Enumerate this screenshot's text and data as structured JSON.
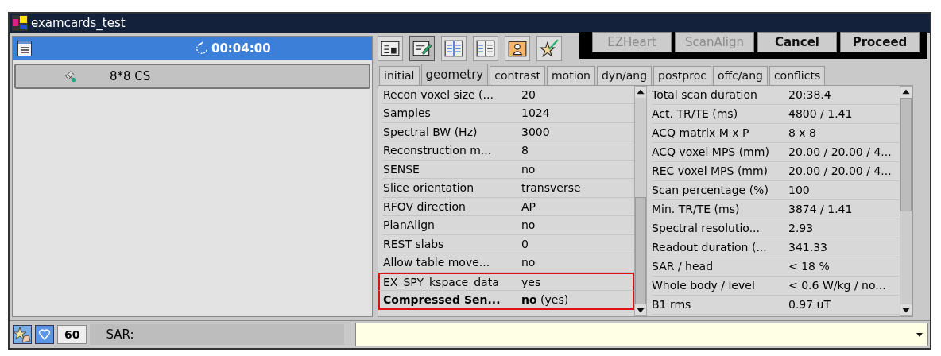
{
  "window": {
    "title": "examcards_test"
  },
  "exam_header": {
    "time": "00:04:00"
  },
  "exam_items": [
    {
      "name": "8*8 CS"
    }
  ],
  "buttons": [
    {
      "label": "EZHeart",
      "disabled": true
    },
    {
      "label": "ScanAlign",
      "disabled": true
    },
    {
      "label": "Cancel",
      "disabled": false
    },
    {
      "label": "Proceed",
      "disabled": false
    }
  ],
  "tabs": [
    {
      "label": "initial",
      "selected": false
    },
    {
      "label": "geometry",
      "selected": true
    },
    {
      "label": "contrast",
      "selected": false
    },
    {
      "label": "motion",
      "selected": false
    },
    {
      "label": "dyn/ang",
      "selected": false
    },
    {
      "label": "postproc",
      "selected": false
    },
    {
      "label": "offc/ang",
      "selected": false
    },
    {
      "label": "conflicts",
      "selected": false
    }
  ],
  "parameters": [
    {
      "label": "Recon voxel size (...",
      "value": "20",
      "bold": false,
      "highlighted": false
    },
    {
      "label": "Samples",
      "value": "1024",
      "bold": false,
      "highlighted": false
    },
    {
      "label": "Spectral BW (Hz)",
      "value": "3000",
      "bold": false,
      "highlighted": false
    },
    {
      "label": "Reconstruction m...",
      "value": "8",
      "bold": false,
      "highlighted": false
    },
    {
      "label": "SENSE",
      "value": "no",
      "bold": false,
      "highlighted": false
    },
    {
      "label": "Slice orientation",
      "value": "transverse",
      "bold": false,
      "highlighted": false
    },
    {
      "label": "RFOV direction",
      "value": "AP",
      "bold": false,
      "highlighted": false
    },
    {
      "label": "PlanAlign",
      "value": "no",
      "bold": false,
      "highlighted": false
    },
    {
      "label": "REST slabs",
      "value": "0",
      "bold": false,
      "highlighted": false
    },
    {
      "label": "Allow table move...",
      "value": "no",
      "bold": false,
      "highlighted": false
    },
    {
      "label": "EX_SPY_kspace_data",
      "value": "yes",
      "bold": false,
      "highlighted": true
    },
    {
      "label": "Compressed Sen...",
      "value": "**no** (yes)",
      "bold": true,
      "highlighted": true
    }
  ],
  "info": [
    {
      "label": "Total scan duration",
      "value": "20:38.4"
    },
    {
      "label": "Act. TR/TE (ms)",
      "value": "4800 / 1.41"
    },
    {
      "label": "ACQ matrix M x P",
      "value": "8 x 8"
    },
    {
      "label": "ACQ voxel MPS (mm)",
      "value": "20.00 / 20.00 / 4..."
    },
    {
      "label": "REC voxel MPS (mm)",
      "value": "20.00 / 20.00 / 4..."
    },
    {
      "label": "Scan percentage (%)",
      "value": "100"
    },
    {
      "label": "Min. TR/TE (ms)",
      "value": "3874 / 1.41"
    },
    {
      "label": "Spectral resolutio...",
      "value": "2.93"
    },
    {
      "label": "Readout duration (...",
      "value": "341.33"
    },
    {
      "label": "SAR / head",
      "value": "< 18 %"
    },
    {
      "label": "Whole body / level",
      "value": "< 0.6 W/kg / no..."
    },
    {
      "label": "B1 rms",
      "value": "0.97 uT"
    }
  ],
  "status_bar": {
    "count": "60",
    "sar_label": "SAR:"
  }
}
